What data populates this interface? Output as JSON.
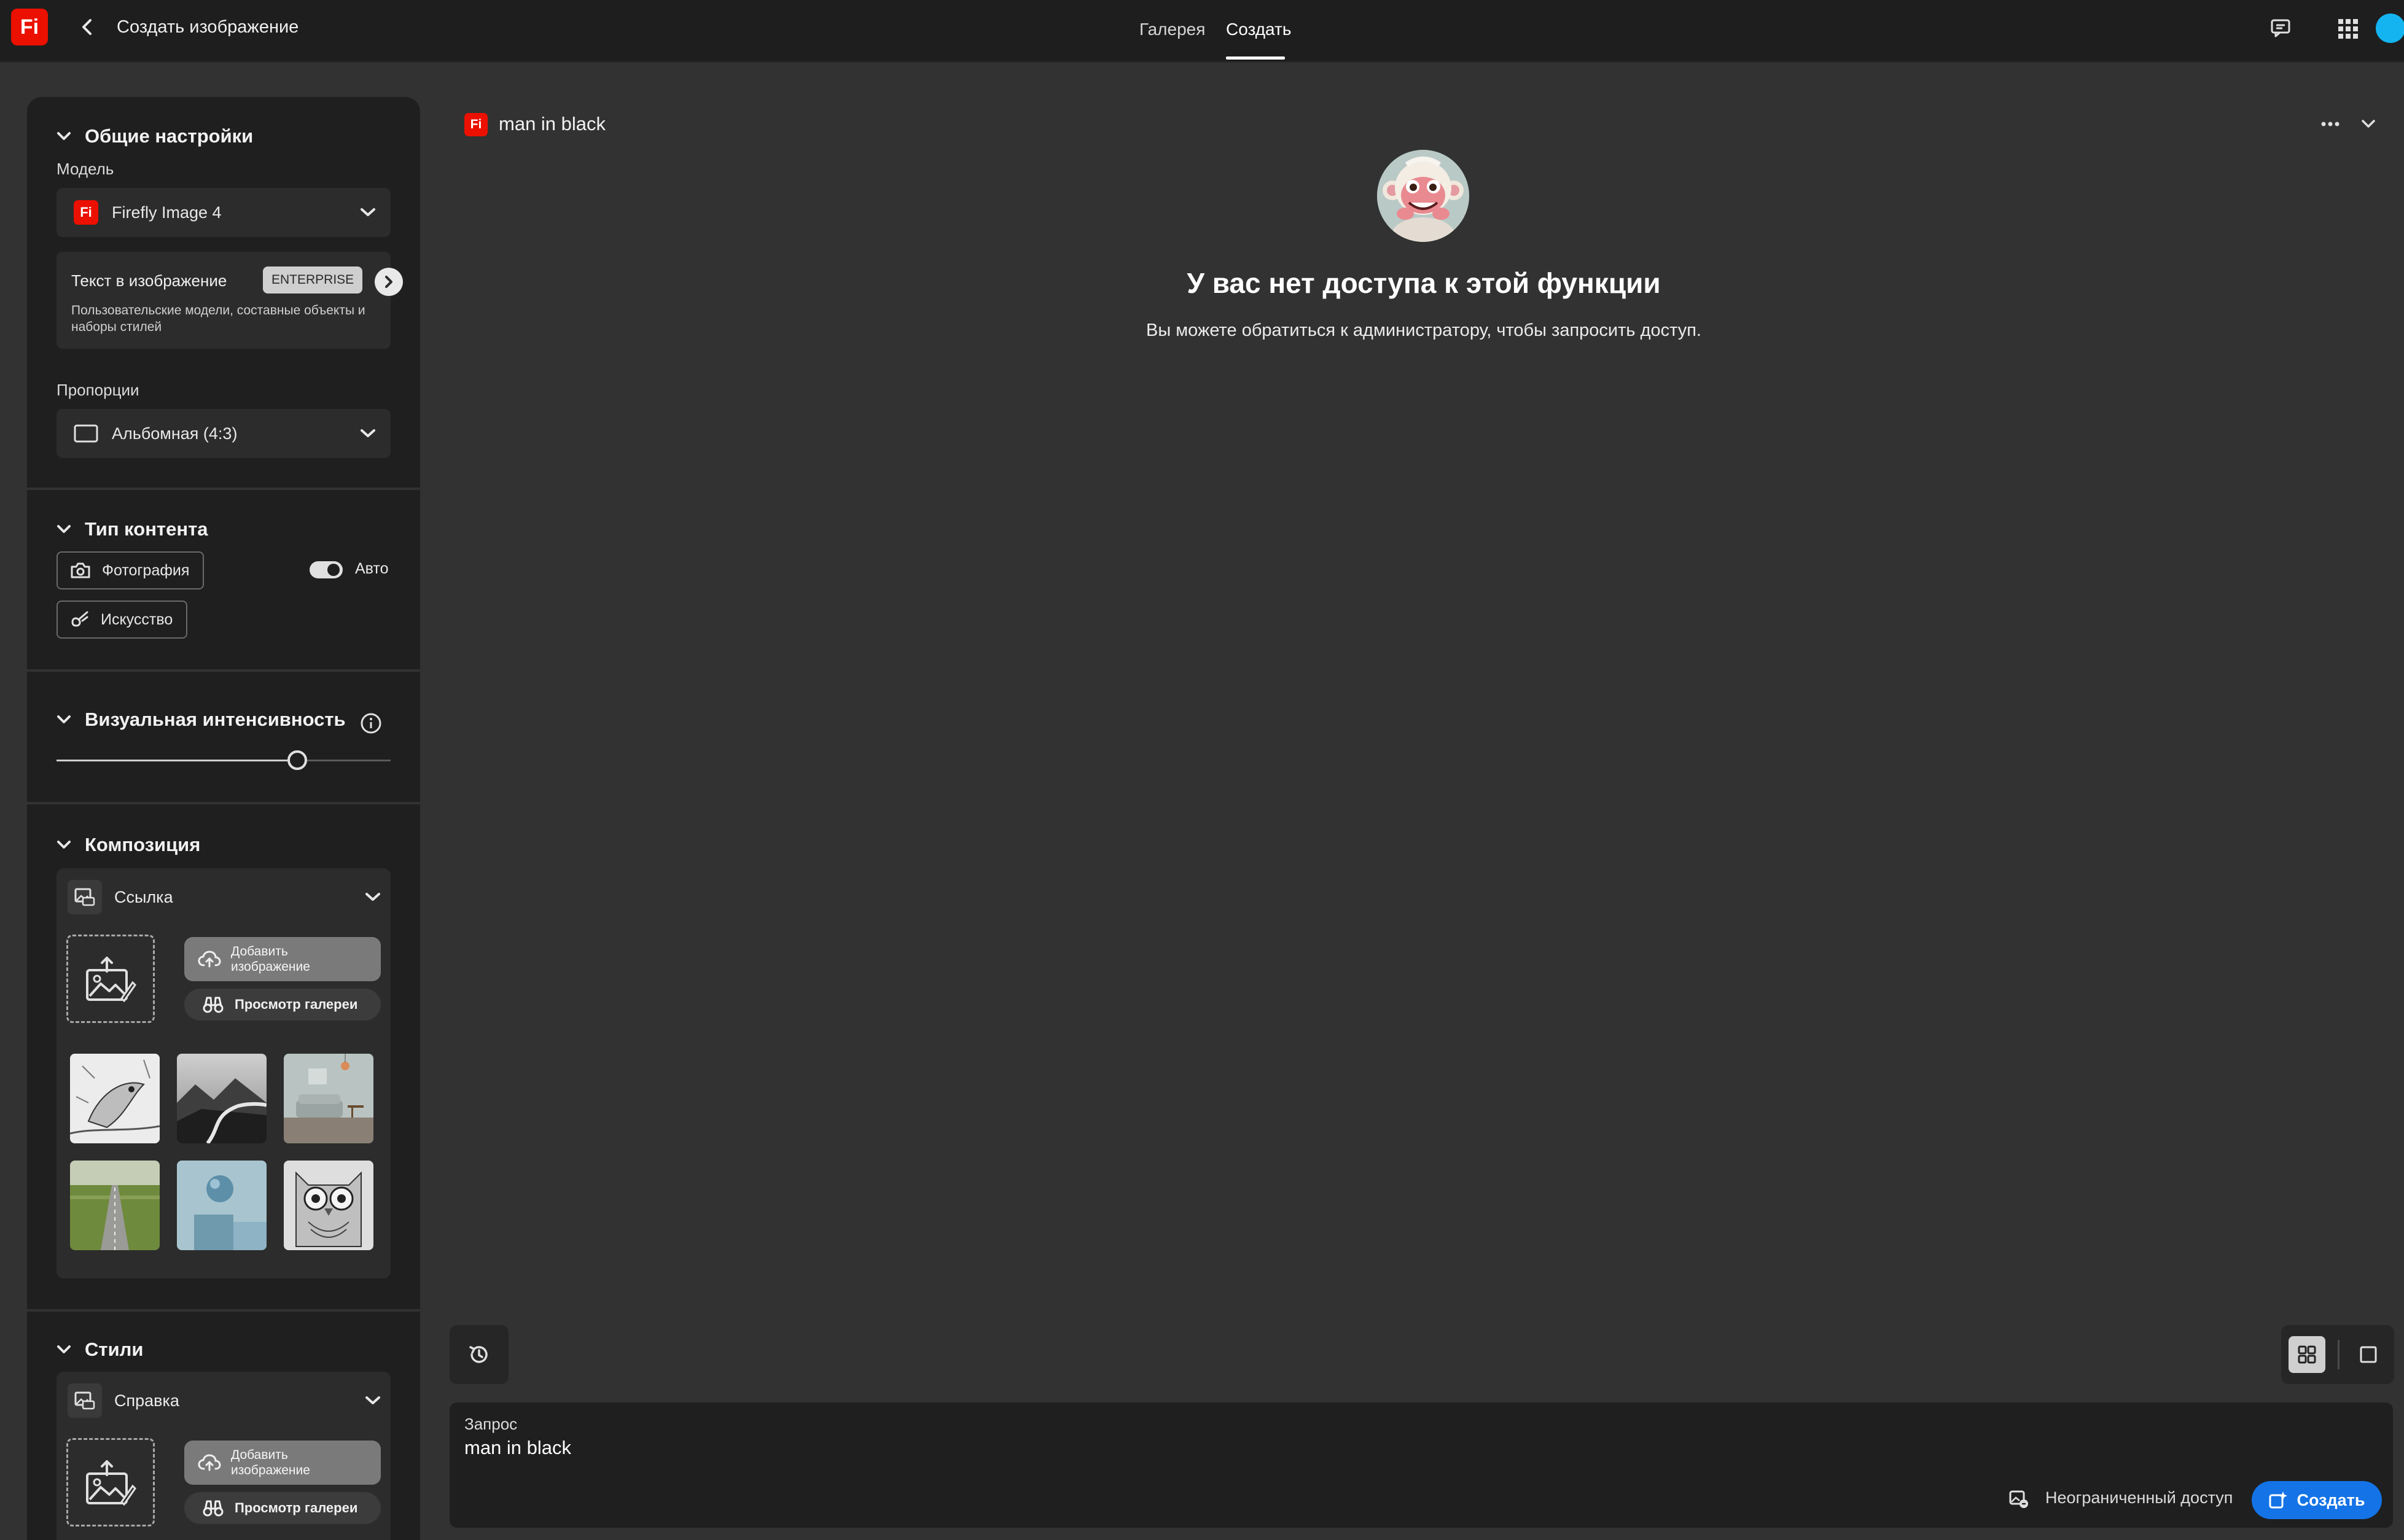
{
  "app": {
    "logo_text": "Fi",
    "title": "Создать изображение"
  },
  "nav": {
    "tabs": [
      {
        "label": "Галерея",
        "active": false
      },
      {
        "label": "Создать",
        "active": true
      }
    ]
  },
  "sidebar": {
    "general": {
      "title": "Общие настройки",
      "model_label": "Модель",
      "model_value": "Firefly Image 4",
      "enterprise_card": {
        "title": "Текст в изображение",
        "badge": "ENTERPRISE",
        "description": "Пользовательские модели, составные объекты и наборы стилей"
      },
      "aspect_label": "Пропорции",
      "aspect_value": "Альбомная (4:3)"
    },
    "content_type": {
      "title": "Тип контента",
      "options": [
        "Фотография",
        "Искусство"
      ],
      "auto_label": "Авто",
      "auto_enabled": true
    },
    "visual_intensity": {
      "title": "Визуальная интенсивность",
      "value_fraction": 0.72
    },
    "composition": {
      "title": "Композиция",
      "card_title": "Ссылка",
      "add_image_label": "Добавить изображение",
      "gallery_label": "Просмотр галереи",
      "thumbnails": [
        "bird-sketch",
        "mountain-river",
        "living-room",
        "green-road",
        "blue-sphere",
        "owl-mandala"
      ]
    },
    "styles": {
      "title": "Стили",
      "card_title": "Справка",
      "add_image_label": "Добавить изображение",
      "gallery_label": "Просмотр галереи"
    }
  },
  "main": {
    "doc_title": "man in black",
    "heading": "У вас нет доступа к этой функции",
    "subtext": "Вы можете обратиться к администратору, чтобы запросить доступ."
  },
  "prompt": {
    "label": "Запрос",
    "value": "man in black",
    "credits_text": "Неограниченный доступ",
    "generate_label": "Создать"
  },
  "colors": {
    "accent": "#1473e6",
    "brand": "#eb1000",
    "background": "#323232",
    "panel": "#1f1f1f"
  }
}
